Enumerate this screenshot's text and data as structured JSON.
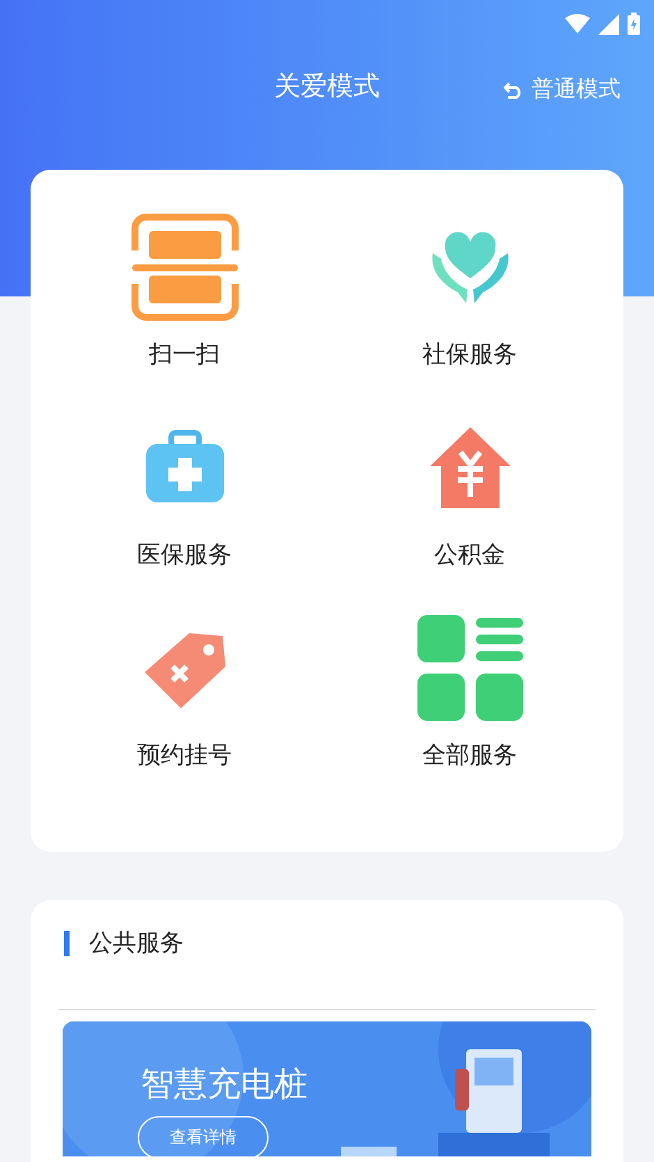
{
  "header": {
    "title": "关爱模式",
    "switch_link": "普通模式"
  },
  "services": [
    {
      "label": "扫一扫"
    },
    {
      "label": "社保服务"
    },
    {
      "label": "医保服务"
    },
    {
      "label": "公积金"
    },
    {
      "label": "预约挂号"
    },
    {
      "label": "全部服务"
    }
  ],
  "public_services": {
    "title": "公共服务",
    "banner": {
      "title": "智慧充电桩",
      "button": "查看详情"
    }
  }
}
